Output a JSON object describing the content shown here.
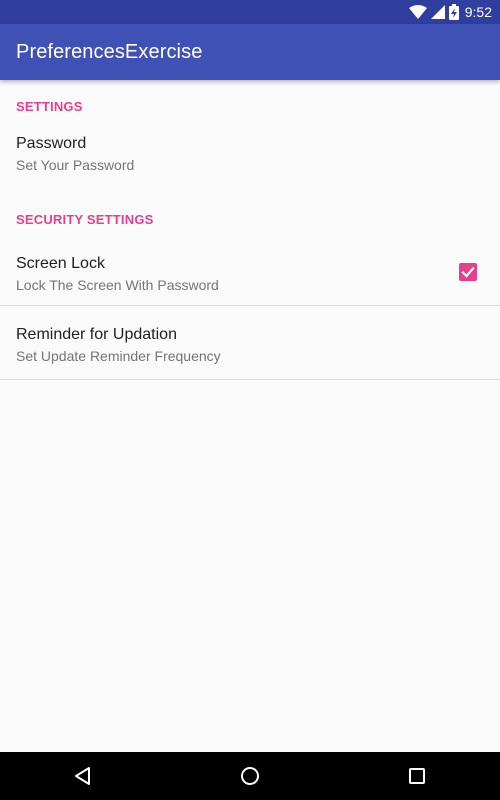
{
  "status_bar": {
    "time": "9:52",
    "icons": [
      "wifi-icon",
      "signal-icon",
      "battery-charging-icon"
    ],
    "background": "#303f9f"
  },
  "app_bar": {
    "title": "PreferencesExercise",
    "background": "#3f51b5"
  },
  "settings": {
    "category_label": "SETTINGS",
    "password": {
      "title": "Password",
      "summary": "Set Your Password"
    }
  },
  "security_settings": {
    "category_label": "SECURITY SETTINGS",
    "screen_lock": {
      "title": "Screen Lock",
      "summary": "Lock The Screen With Password",
      "checked": true
    },
    "reminder": {
      "title": "Reminder for Updation",
      "summary": "Set Update Reminder Frequency"
    }
  },
  "colors": {
    "accent": "#e83e8c",
    "primary": "#3f51b5",
    "primary_dark": "#303f9f"
  },
  "nav_bar": {
    "buttons": [
      "back-icon",
      "home-icon",
      "recents-icon"
    ]
  }
}
